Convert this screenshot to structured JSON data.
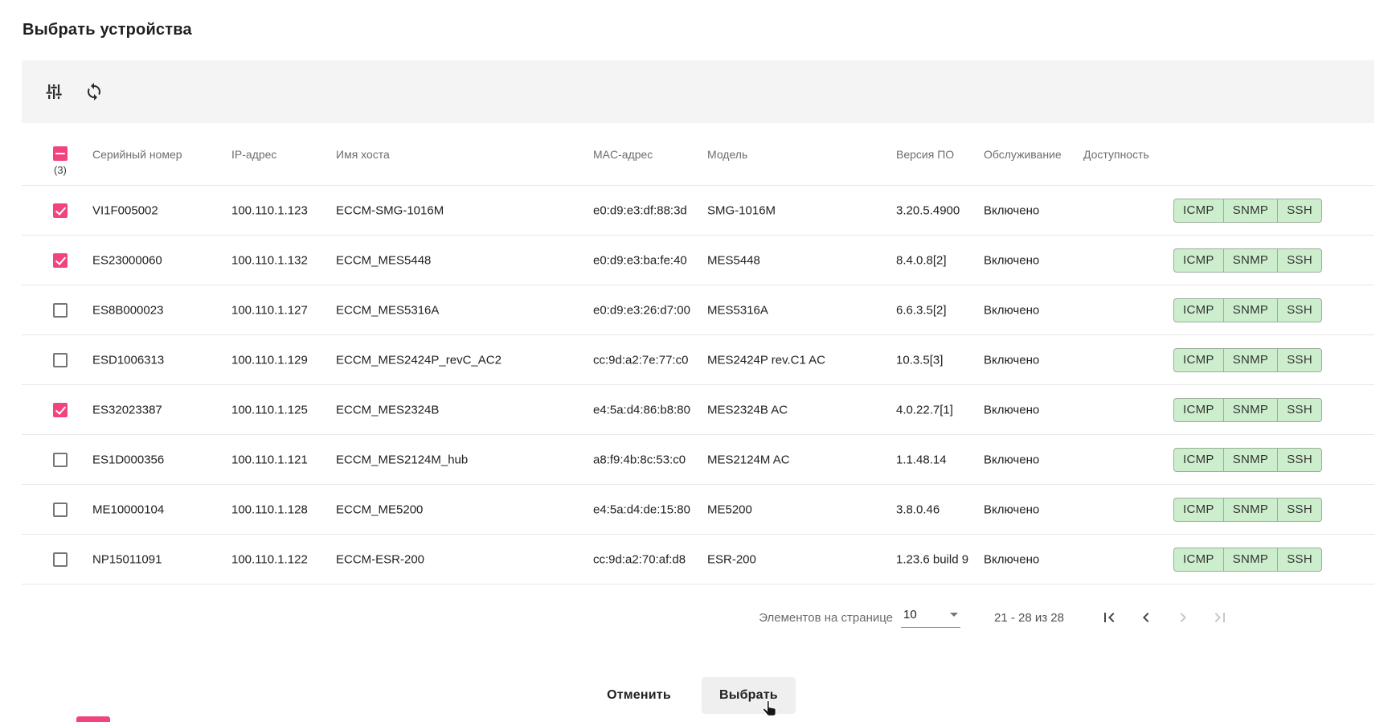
{
  "page": {
    "title": "Выбрать устройства"
  },
  "toolbar": {
    "filter_icon": "tune-sliders-icon",
    "refresh_icon": "sync-icon"
  },
  "table": {
    "select_all": {
      "state": "indeterminate",
      "selected_count_label": "(3)"
    },
    "columns": [
      "Серийный номер",
      "IP-адрес",
      "Имя хоста",
      "MAC-адрес",
      "Модель",
      "Версия ПО",
      "Обслуживание",
      "Доступность"
    ],
    "availability_labels": [
      "ICMP",
      "SNMP",
      "SSH"
    ],
    "rows": [
      {
        "checked": true,
        "serial": "VI1F005002",
        "ip": "100.110.1.123",
        "hostname": "ECCM-SMG-1016M",
        "mac": "e0:d9:e3:df:88:3d",
        "model": "SMG-1016M",
        "version": "3.20.5.4900",
        "maintenance": "Включено"
      },
      {
        "checked": true,
        "serial": "ES23000060",
        "ip": "100.110.1.132",
        "hostname": "ECCM_MES5448",
        "mac": "e0:d9:e3:ba:fe:40",
        "model": "MES5448",
        "version": "8.4.0.8[2]",
        "maintenance": "Включено"
      },
      {
        "checked": false,
        "serial": "ES8B000023",
        "ip": "100.110.1.127",
        "hostname": "ECCM_MES5316A",
        "mac": "e0:d9:e3:26:d7:00",
        "model": "MES5316A",
        "version": "6.6.3.5[2]",
        "maintenance": "Включено"
      },
      {
        "checked": false,
        "serial": "ESD1006313",
        "ip": "100.110.1.129",
        "hostname": "ECCM_MES2424P_revC_AC2",
        "mac": "cc:9d:a2:7e:77:c0",
        "model": "MES2424P rev.C1 AC",
        "version": "10.3.5[3]",
        "maintenance": "Включено"
      },
      {
        "checked": true,
        "serial": "ES32023387",
        "ip": "100.110.1.125",
        "hostname": "ECCM_MES2324B",
        "mac": "e4:5a:d4:86:b8:80",
        "model": "MES2324B AC",
        "version": "4.0.22.7[1]",
        "maintenance": "Включено"
      },
      {
        "checked": false,
        "serial": "ES1D000356",
        "ip": "100.110.1.121",
        "hostname": "ECCM_MES2124M_hub",
        "mac": "a8:f9:4b:8c:53:c0",
        "model": "MES2124M AC",
        "version": "1.1.48.14",
        "maintenance": "Включено"
      },
      {
        "checked": false,
        "serial": "ME10000104",
        "ip": "100.110.1.128",
        "hostname": "ECCM_ME5200",
        "mac": "e4:5a:d4:de:15:80",
        "model": "ME5200",
        "version": "3.8.0.46",
        "maintenance": "Включено"
      },
      {
        "checked": false,
        "serial": "NP15011091",
        "ip": "100.110.1.122",
        "hostname": "ECCM-ESR-200",
        "mac": "cc:9d:a2:70:af:d8",
        "model": "ESR-200",
        "version": "1.23.6 build 9",
        "maintenance": "Включено"
      }
    ]
  },
  "pagination": {
    "items_per_page_label": "Элементов на странице",
    "items_per_page_value": "10",
    "range_label": "21 - 28 из 28",
    "first_enabled": true,
    "prev_enabled": true,
    "next_enabled": false,
    "last_enabled": false
  },
  "footer": {
    "cancel_label": "Отменить",
    "select_label": "Выбрать"
  },
  "colors": {
    "accent_pink": "#f2437f",
    "badge_green_bg": "#cdeecd",
    "badge_green_border": "#9bad9b",
    "toolbar_bg": "#f4f4f4"
  }
}
